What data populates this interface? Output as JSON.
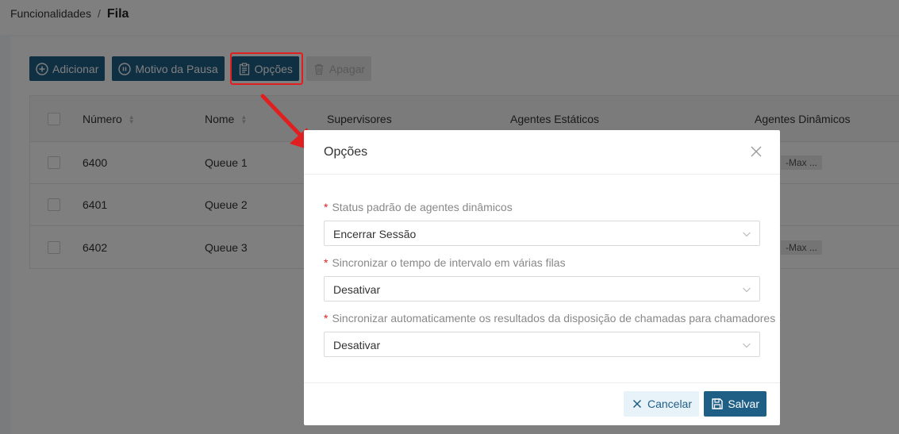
{
  "breadcrumb": {
    "parent": "Funcionalidades",
    "separator": "/",
    "current": "Fila"
  },
  "toolbar": {
    "add_label": "Adicionar",
    "pause_reason_label": "Motivo da Pausa",
    "options_label": "Opções",
    "delete_label": "Apagar"
  },
  "table": {
    "headers": {
      "number": "Número",
      "name": "Nome",
      "supervisors": "Supervisores",
      "static_agents": "Agentes Estáticos",
      "dynamic_agents": "Agentes Dinâmicos"
    },
    "rows": [
      {
        "number": "6400",
        "name": "Queue 1",
        "dynamic_tag": "-Max ..."
      },
      {
        "number": "6401",
        "name": "Queue 2",
        "dynamic_tag": ""
      },
      {
        "number": "6402",
        "name": "Queue 3",
        "dynamic_tag": "-Max ..."
      }
    ]
  },
  "modal": {
    "title": "Opções",
    "fields": [
      {
        "label": "Status padrão de agentes dinâmicos",
        "value": "Encerrar Sessão"
      },
      {
        "label": "Sincronizar o tempo de intervalo em várias filas",
        "value": "Desativar"
      },
      {
        "label": "Sincronizar automaticamente os resultados da disposição de chamadas para chamadores",
        "value": "Desativar"
      }
    ],
    "cancel_label": "Cancelar",
    "save_label": "Salvar"
  },
  "colors": {
    "primary": "#1f5f86",
    "highlight": "#e02020",
    "required": "#e02020"
  }
}
